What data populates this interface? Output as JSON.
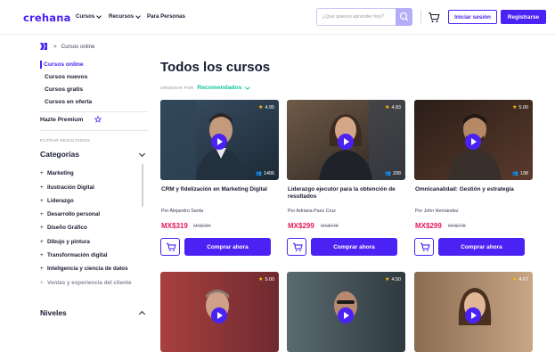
{
  "header": {
    "logo": "crehana",
    "nav": [
      "Cursos",
      "Recursos",
      "Para Personas"
    ],
    "search_placeholder": "¿Qué quieres aprender hoy?",
    "login_label": "Iniciar sesión",
    "register_label": "Registrarse"
  },
  "breadcrumb": {
    "current": "Cursos online"
  },
  "sidebar": {
    "links": [
      "Cursos online",
      "Cursos nuevos",
      "Cursos gratis",
      "Cursos en oferta"
    ],
    "premium": "Hazte Premium",
    "filter_label": "FILTRAR RESULTADOS",
    "categories_title": "Categorías",
    "categories": [
      "Marketing",
      "Ilustración Digital",
      "Liderazgo",
      "Desarrollo personal",
      "Diseño Gráfico",
      "Dibujo y pintura",
      "Transformación digital",
      "Inteligencia y ciencia de datos",
      "Ventas y experiencia del cliente"
    ],
    "levels_title": "Niveles"
  },
  "main": {
    "title": "Todos los cursos",
    "sort_label": "ORDENAR POR",
    "sort_value": "Recomendados",
    "buy_label": "Comprar ahora",
    "courses": [
      {
        "rating": "4.95",
        "students": "1406",
        "title": "CRM y fidelización en Marketing Digital",
        "author": "Por Alejandro Santa",
        "price": "MX$319",
        "old_price": "MX$484"
      },
      {
        "rating": "4.83",
        "students": "208",
        "title": "Liderazgo ejecutor para la obtención de resultados",
        "author": "Por Adriana Paez Cruz",
        "price": "MX$299",
        "old_price": "MX$748"
      },
      {
        "rating": "5.00",
        "students": "198",
        "title": "Omnicanalidad: Gestión y estrategia",
        "author": "Por John Hernández",
        "price": "MX$299",
        "old_price": "MX$748"
      },
      {
        "rating": "5.00"
      },
      {
        "rating": "4.50"
      },
      {
        "rating": "4.67"
      }
    ]
  },
  "colors": {
    "brand": "#4b22f4",
    "price": "#e61a58",
    "sort": "#12c79f"
  }
}
